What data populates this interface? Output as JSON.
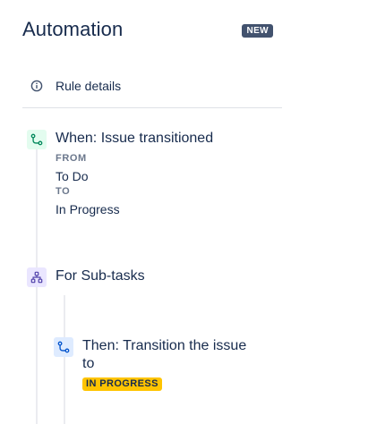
{
  "header": {
    "title": "Automation",
    "badge": "NEW"
  },
  "rule_details": {
    "icon": "info-icon",
    "label": "Rule details"
  },
  "steps": [
    {
      "icon": "transition-icon",
      "title": "When: Issue transitioned",
      "from_label": "FROM",
      "from_value": "To Do",
      "to_label": "TO",
      "to_value": "In Progress"
    },
    {
      "icon": "hierarchy-icon",
      "title": "For Sub-tasks"
    },
    {
      "icon": "transition-icon",
      "title_line1": "Then: Transition the issue",
      "title_line2": "to",
      "status": "IN PROGRESS"
    }
  ],
  "colors": {
    "text": "#172B4D",
    "subtle_text": "#6B778C",
    "badge_bg": "#42526E",
    "trigger_bg": "#E3FCEF",
    "trigger_fg": "#00875A",
    "branch_bg": "#EAE6FF",
    "branch_fg": "#5243AA",
    "action_bg": "#DEEBFF",
    "action_fg": "#0052CC",
    "status_bg": "#FFC400",
    "connector": "#EBECF0"
  }
}
